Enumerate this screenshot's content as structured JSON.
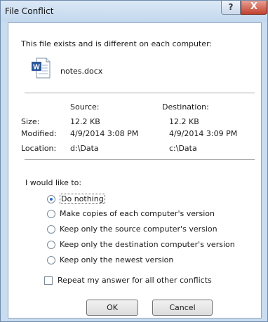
{
  "window": {
    "title": "File Conflict",
    "help_label": "?",
    "close_label": "X"
  },
  "message": "This file exists and is different on each computer:",
  "file": {
    "icon": "word-document-icon",
    "icon_letter": "W",
    "name": "notes.docx"
  },
  "details": {
    "source_header": "Source:",
    "destination_header": "Destination:",
    "rows": [
      {
        "label": "Size:",
        "source": "12.2 KB",
        "destination": "12.2 KB"
      },
      {
        "label": "Modified:",
        "source": "4/9/2014 3:08 PM",
        "destination": "4/9/2014 3:09 PM"
      },
      {
        "label": "Location:",
        "source": "d:\\Data",
        "destination": "c:\\Data"
      }
    ]
  },
  "prompt": "I would like to:",
  "options": [
    {
      "label": "Do nothing",
      "selected": true
    },
    {
      "label": "Make copies of each computer's version",
      "selected": false
    },
    {
      "label": "Keep only the source computer's version",
      "selected": false
    },
    {
      "label": "Keep only the destination computer's version",
      "selected": false
    },
    {
      "label": "Keep only the newest version",
      "selected": false
    }
  ],
  "repeat_checkbox": {
    "label": "Repeat my answer for all other conflicts",
    "checked": false
  },
  "buttons": {
    "ok": "OK",
    "cancel": "Cancel"
  },
  "colors": {
    "frame": "#c9dcf0",
    "close": "#c2432f",
    "radio_dot": "#2a6fca",
    "word_blue": "#2b579a"
  }
}
